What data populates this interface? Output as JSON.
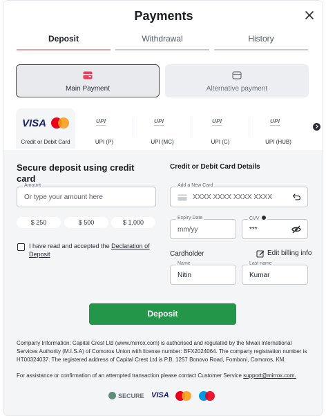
{
  "header": {
    "title": "Payments"
  },
  "tabs": [
    {
      "label": "Deposit",
      "active": true
    },
    {
      "label": "Withdrawal",
      "active": false
    },
    {
      "label": "History",
      "active": false
    }
  ],
  "methods": [
    {
      "label": "Main Payment",
      "selected": true,
      "icon": "wallet-icon"
    },
    {
      "label": "Alternative payment",
      "selected": false,
      "icon": "wallet-icon"
    }
  ],
  "cards": [
    {
      "label": "Credit or Debit Card",
      "logos": [
        "VISA",
        "Mastercard"
      ],
      "active": true
    },
    {
      "label": "UPI (P)",
      "logo": "UPI"
    },
    {
      "label": "UPI (MC)",
      "logo": "UPI"
    },
    {
      "label": "UPI (C)",
      "logo": "UPI"
    },
    {
      "label": "UPI (HUB)",
      "logo": "UPI"
    }
  ],
  "deposit": {
    "title": "Secure deposit using credit card",
    "amount_label": "Amount",
    "amount_placeholder": "Or type your amount here",
    "quick_amounts": [
      "$ 250",
      "$ 500",
      "$ 1,000"
    ],
    "consent_prefix": "I have read and accepted the ",
    "consent_link": "Declaration of Deposit"
  },
  "card_details": {
    "title": "Credit or Debit Card Details",
    "card_label": "Add a New Card",
    "card_placeholder": "XXXX XXXX XXXX XXXX",
    "expiry_label": "Expiry Date",
    "expiry_placeholder": "mm/yy",
    "cvv_label": "CVV",
    "cvv_value": "***",
    "cardholder_label": "Cardholder",
    "edit_billing": "Edit billing info",
    "name_label": "Name",
    "name_value": "Nitin",
    "lastname_label": "Last name",
    "lastname_value": "Kumar"
  },
  "deposit_button": "Deposit",
  "company_info": "Company Information: Capital Crest Ltd (www.mirrox.com) is authorised and regulated by the Mwali International Services Authority (M.I.S.A) of Comoros Union with license number: BFX2024064. The company registration number is HT00324037. The registered address of Capital Crest Ltd is P.B. 1257 Bonovo Road, Fomboni, Comoros, KM.",
  "support_text": "For assistance or confirmation of an attempted transaction please contact Customer Service ",
  "support_email": "support@mirrox.com.",
  "badges": {
    "secure": "SECURE",
    "visa": "VISA"
  },
  "colors": {
    "accent": "#23964a",
    "active_tab": "#e9a1a5",
    "mastercard_red": "#eb001b",
    "mastercard_orange": "#f79e1b",
    "maestro_blue": "#0099df"
  }
}
